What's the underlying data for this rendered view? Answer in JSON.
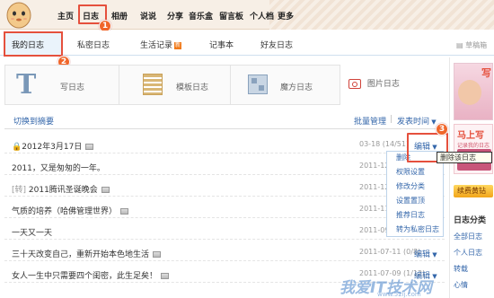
{
  "nav": {
    "items": [
      "主页",
      "日志",
      "相册",
      "说说",
      "分享",
      "音乐盒",
      "留言板",
      "个人档",
      "更多"
    ]
  },
  "tabs": {
    "items": [
      "我的日志",
      "私密日志",
      "生活记录",
      "记事本",
      "好友日志"
    ],
    "new_badge": "新",
    "right_link": "草稿箱"
  },
  "write": {
    "write_label": "写日志",
    "template_label": "模板日志",
    "magic_label": "魔方日志",
    "photo_label": "图片日志"
  },
  "toolbar": {
    "switch_summary": "切换到摘要",
    "batch": "批量管理",
    "sort": "发表时间"
  },
  "list": [
    {
      "title": "2012年3月17日",
      "date": "03-18 (14/51)",
      "action": "编辑",
      "pre": "",
      "img": true,
      "lock": true
    },
    {
      "title": "2011，又是匆匆的一年。",
      "date": "2011-12-30",
      "action": "",
      "pre": "",
      "img": false,
      "lock": false
    },
    {
      "title": "2011腾讯圣诞晚会",
      "date": "2011-12-19",
      "action": "",
      "pre": "[转] ",
      "img": true,
      "lock": false
    },
    {
      "title": "气质的培养（哈佛管理世界）",
      "date": "2011-11-17",
      "action": "",
      "pre": "",
      "img": true,
      "lock": false
    },
    {
      "title": "一天又一天",
      "date": "2011-09-20",
      "action": "",
      "pre": "",
      "img": false,
      "lock": false
    },
    {
      "title": "三十天改变自己，重新开始本色地生活",
      "date": "2011-07-11 (0/8)",
      "action": "编辑",
      "pre": "",
      "img": true,
      "lock": false
    },
    {
      "title": "女人一生中只需要四个闺密，此生足矣！",
      "date": "2011-07-09 (1/12)",
      "action": "编辑",
      "pre": "",
      "img": true,
      "lock": false
    }
  ],
  "menu": {
    "items": [
      "删除",
      "权限设置",
      "修改分类",
      "设置置顶",
      "推荐日志",
      "转为私密日志"
    ]
  },
  "tooltip": "删除该日志",
  "markers": [
    "1",
    "2",
    "3"
  ],
  "sidebar": {
    "banner": "马上写",
    "banner_sub": "记录我的日志",
    "vip": "续费黄钻",
    "category_title": "日志分类",
    "all_label": "全部日志",
    "items": [
      "个人日志",
      "转载",
      "心情"
    ]
  },
  "watermark": {
    "line1": "我爱IT技术网",
    "line2": "www.52ij.com"
  },
  "colors": {
    "accent": "#e5503d",
    "link": "#3366aa",
    "tab_bg": "#eaf3fb"
  }
}
